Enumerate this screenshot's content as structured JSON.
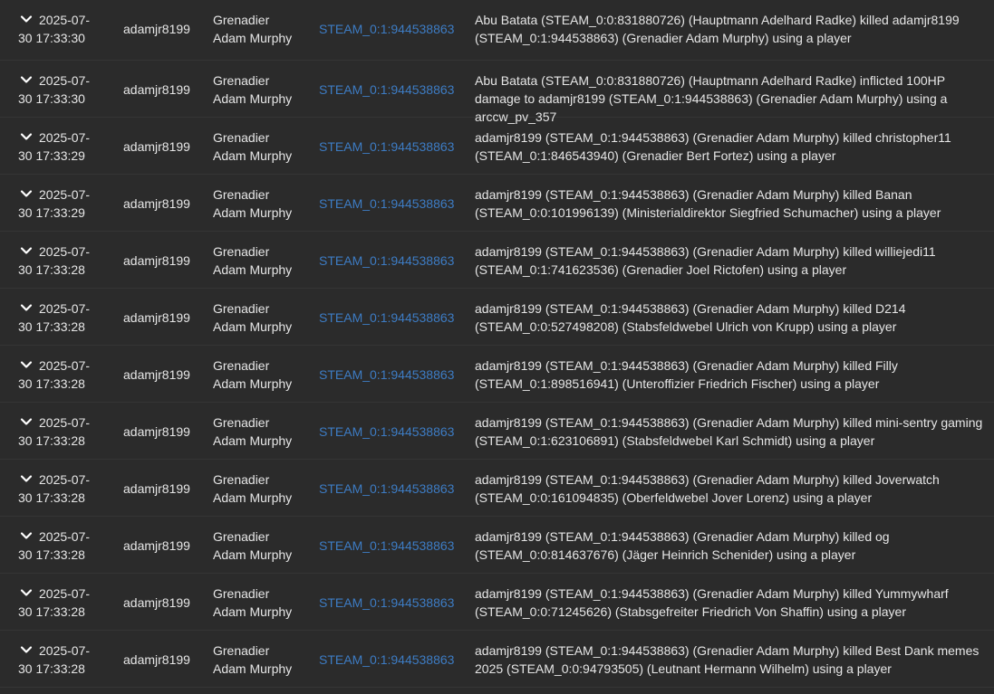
{
  "rows": [
    {
      "date": "2025-07-",
      "time": "30 17:33:30",
      "user": "adamjr8199",
      "char_rank": "Grenadier",
      "char_name": "Adam Murphy",
      "steam": "STEAM_0:1:944538863",
      "message": "Abu Batata (STEAM_0:0:831880726) (Hauptmann Adelhard Radke) killed adamjr8199 (STEAM_0:1:944538863) (Grenadier Adam Murphy) using a player"
    },
    {
      "date": "2025-07-",
      "time": "30 17:33:30",
      "user": "adamjr8199",
      "char_rank": "Grenadier",
      "char_name": "Adam Murphy",
      "steam": "STEAM_0:1:944538863",
      "message": "Abu Batata (STEAM_0:0:831880726) (Hauptmann Adelhard Radke) inflicted 100HP damage to adamjr8199 (STEAM_0:1:944538863) (Grenadier Adam Murphy) using a arccw_pv_357"
    },
    {
      "date": "2025-07-",
      "time": "30 17:33:29",
      "user": "adamjr8199",
      "char_rank": "Grenadier",
      "char_name": "Adam Murphy",
      "steam": "STEAM_0:1:944538863",
      "message": "adamjr8199 (STEAM_0:1:944538863) (Grenadier Adam Murphy) killed christopher11 (STEAM_0:1:846543940) (Grenadier Bert Fortez) using a player"
    },
    {
      "date": "2025-07-",
      "time": "30 17:33:29",
      "user": "adamjr8199",
      "char_rank": "Grenadier",
      "char_name": "Adam Murphy",
      "steam": "STEAM_0:1:944538863",
      "message": "adamjr8199 (STEAM_0:1:944538863) (Grenadier Adam Murphy) killed Banan (STEAM_0:0:101996139) (Ministerialdirektor Siegfried Schumacher) using a player"
    },
    {
      "date": "2025-07-",
      "time": "30 17:33:28",
      "user": "adamjr8199",
      "char_rank": "Grenadier",
      "char_name": "Adam Murphy",
      "steam": "STEAM_0:1:944538863",
      "message": "adamjr8199 (STEAM_0:1:944538863) (Grenadier Adam Murphy) killed williejedi11 (STEAM_0:1:741623536) (Grenadier Joel Rictofen) using a player"
    },
    {
      "date": "2025-07-",
      "time": "30 17:33:28",
      "user": "adamjr8199",
      "char_rank": "Grenadier",
      "char_name": "Adam Murphy",
      "steam": "STEAM_0:1:944538863",
      "message": "adamjr8199 (STEAM_0:1:944538863) (Grenadier Adam Murphy) killed D214 (STEAM_0:0:527498208) (Stabsfeldwebel Ulrich von Krupp) using a player"
    },
    {
      "date": "2025-07-",
      "time": "30 17:33:28",
      "user": "adamjr8199",
      "char_rank": "Grenadier",
      "char_name": "Adam Murphy",
      "steam": "STEAM_0:1:944538863",
      "message": "adamjr8199 (STEAM_0:1:944538863) (Grenadier Adam Murphy) killed Filly (STEAM_0:1:898516941) (Unteroffizier Friedrich Fischer) using a player"
    },
    {
      "date": "2025-07-",
      "time": "30 17:33:28",
      "user": "adamjr8199",
      "char_rank": "Grenadier",
      "char_name": "Adam Murphy",
      "steam": "STEAM_0:1:944538863",
      "message": "adamjr8199 (STEAM_0:1:944538863) (Grenadier Adam Murphy) killed mini-sentry gaming (STEAM_0:1:623106891) (Stabsfeldwebel Karl Schmidt) using a player"
    },
    {
      "date": "2025-07-",
      "time": "30 17:33:28",
      "user": "adamjr8199",
      "char_rank": "Grenadier",
      "char_name": "Adam Murphy",
      "steam": "STEAM_0:1:944538863",
      "message": "adamjr8199 (STEAM_0:1:944538863) (Grenadier Adam Murphy) killed Joverwatch (STEAM_0:0:161094835) (Oberfeldwebel Jover Lorenz) using a player"
    },
    {
      "date": "2025-07-",
      "time": "30 17:33:28",
      "user": "adamjr8199",
      "char_rank": "Grenadier",
      "char_name": "Adam Murphy",
      "steam": "STEAM_0:1:944538863",
      "message": "adamjr8199 (STEAM_0:1:944538863) (Grenadier Adam Murphy) killed og (STEAM_0:0:814637676) (Jäger Heinrich Schenider) using a player"
    },
    {
      "date": "2025-07-",
      "time": "30 17:33:28",
      "user": "adamjr8199",
      "char_rank": "Grenadier",
      "char_name": "Adam Murphy",
      "steam": "STEAM_0:1:944538863",
      "message": "adamjr8199 (STEAM_0:1:944538863) (Grenadier Adam Murphy) killed Yummywharf (STEAM_0:0:71245626) (Stabsgefreiter Friedrich Von Shaffin) using a player"
    },
    {
      "date": "2025-07-",
      "time": "30 17:33:28",
      "user": "adamjr8199",
      "char_rank": "Grenadier",
      "char_name": "Adam Murphy",
      "steam": "STEAM_0:1:944538863",
      "message": "adamjr8199 (STEAM_0:1:944538863) (Grenadier Adam Murphy) killed Best Dank memes 2025 (STEAM_0:0:94793505) (Leutnant Hermann Wilhelm) using a player"
    }
  ],
  "icons": {
    "expand": "chevron-down-icon"
  },
  "colors": {
    "background": "#2b2b2b",
    "text": "#e6e6e6",
    "link": "#3d7cc4"
  }
}
